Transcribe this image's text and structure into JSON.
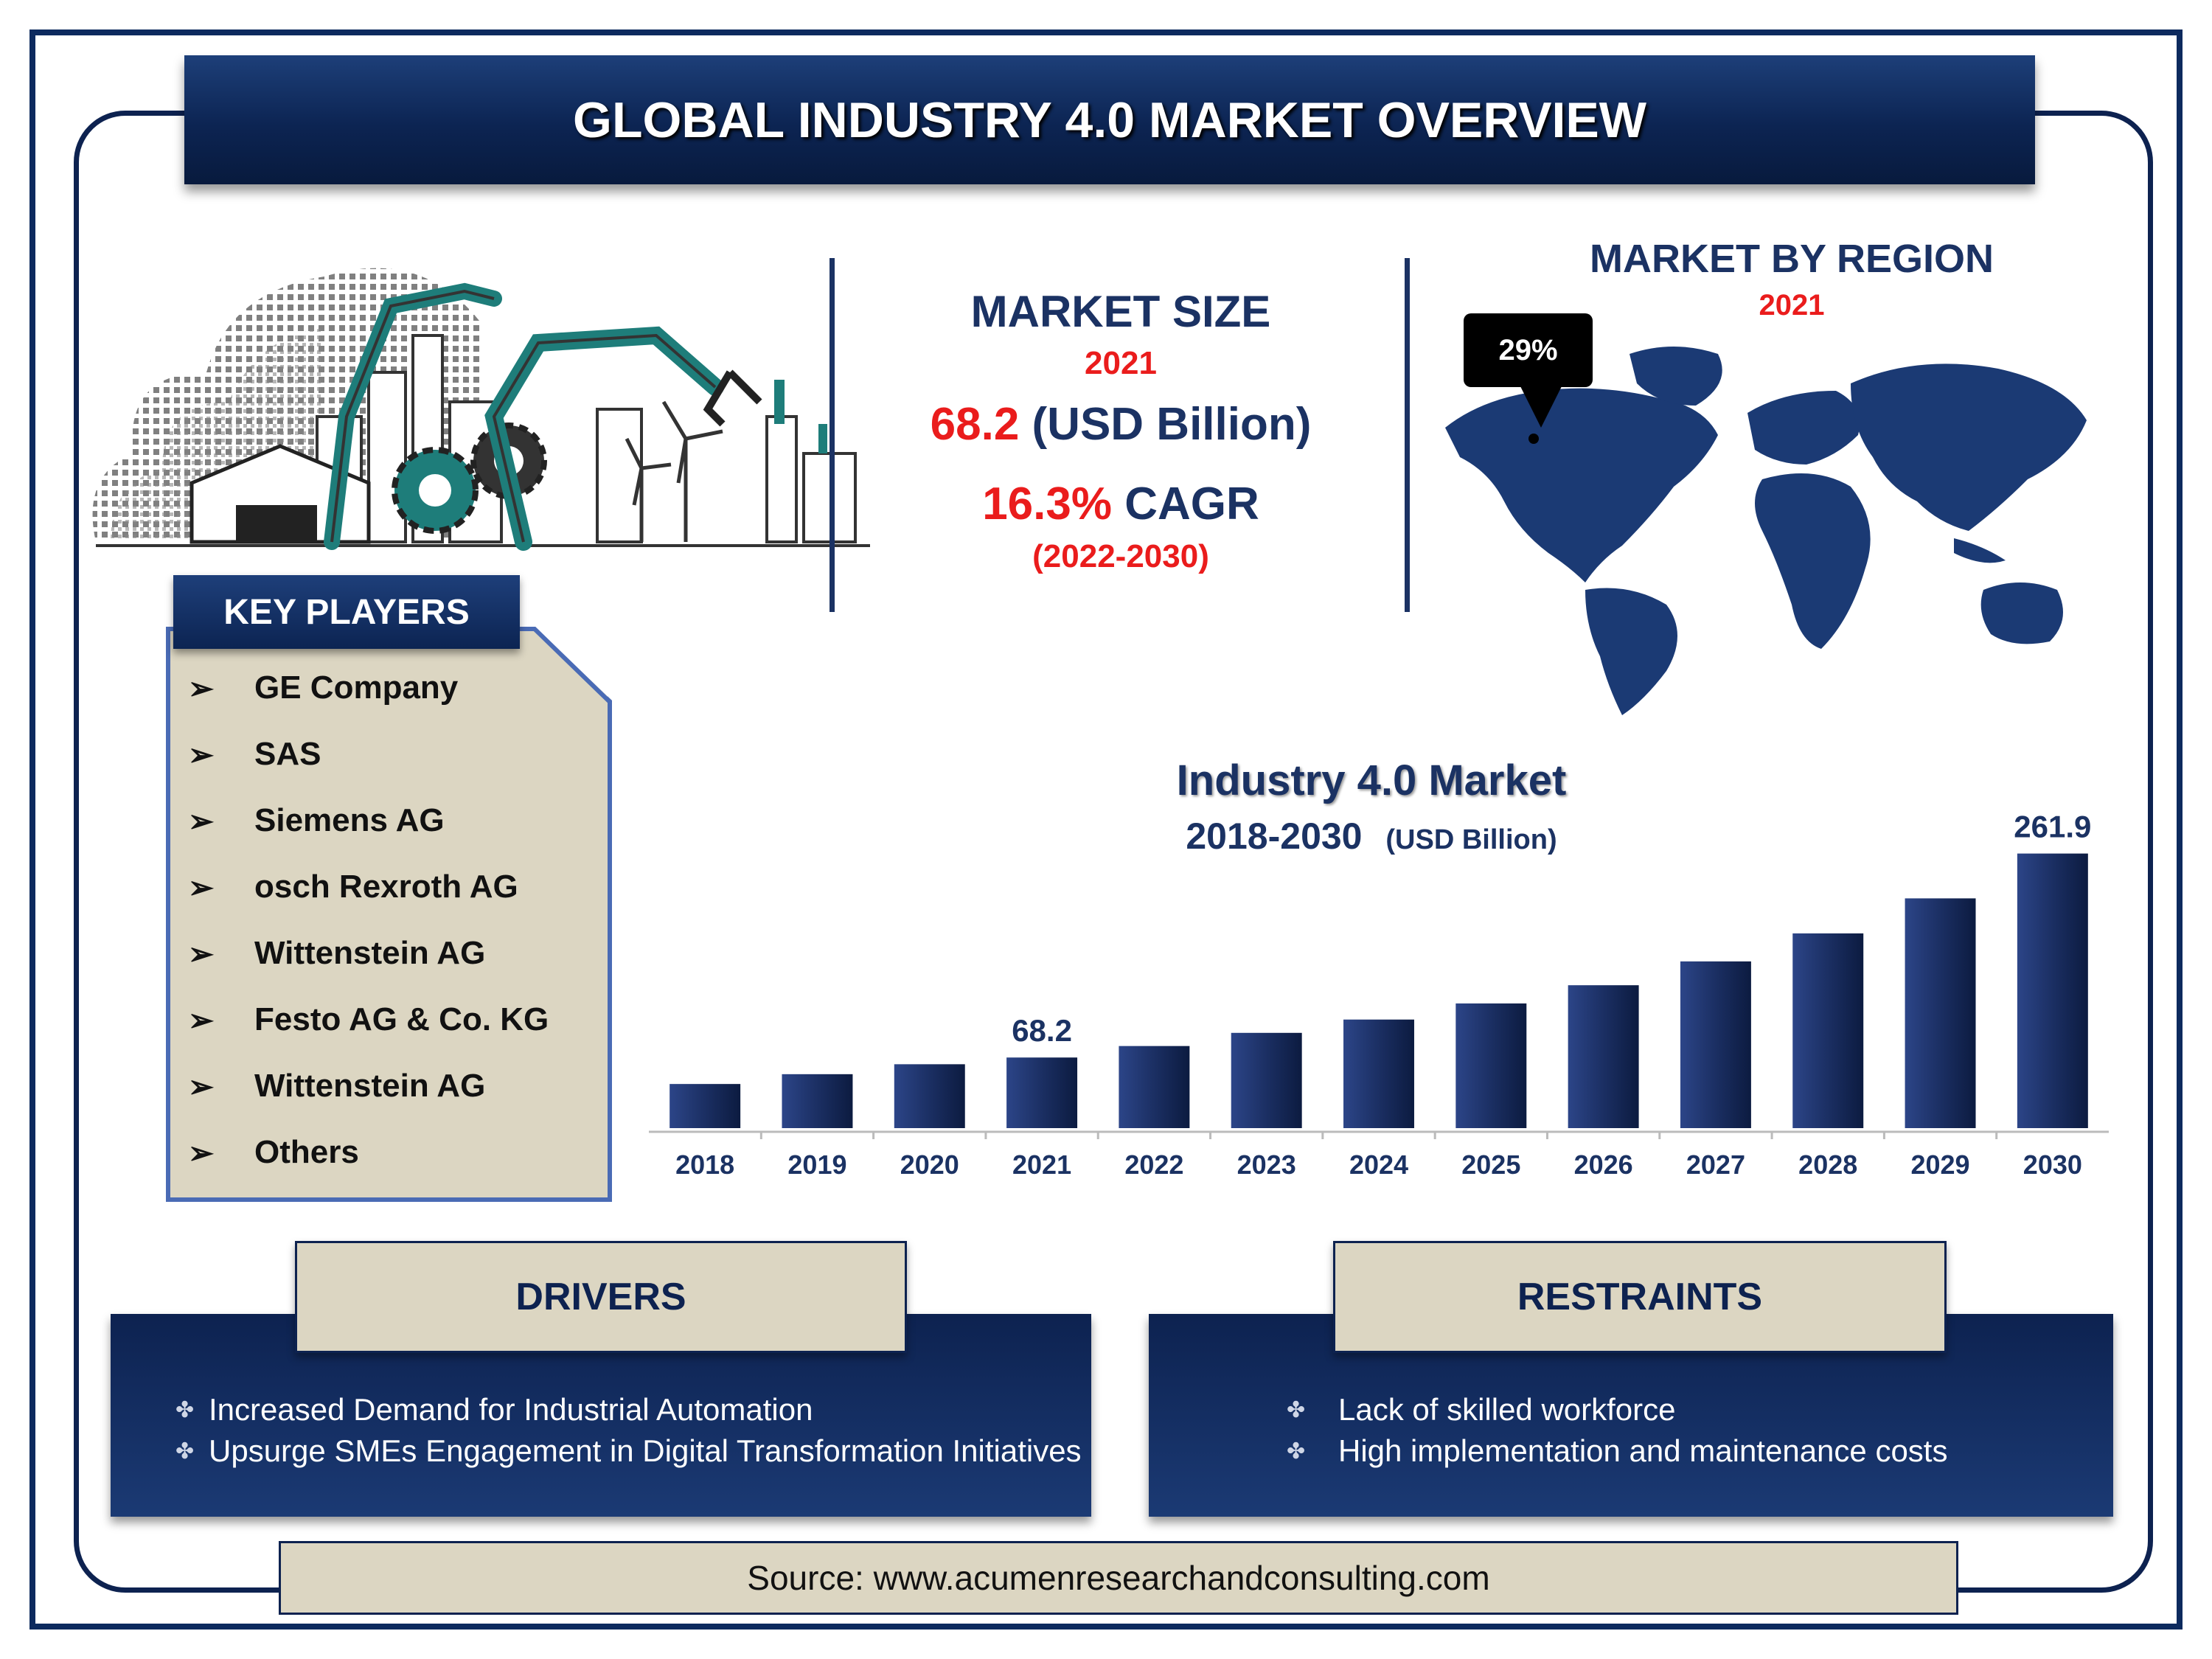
{
  "title": "GLOBAL INDUSTRY 4.0 MARKET OVERVIEW",
  "market_size": {
    "heading": "MARKET SIZE",
    "year": "2021",
    "value": "68.2",
    "unit": "(USD Billion)",
    "cagr_value": "16.3%",
    "cagr_label": "CAGR",
    "period": "(2022-2030)"
  },
  "market_by_region": {
    "heading": "MARKET BY REGION",
    "year": "2021",
    "callout": "29%"
  },
  "key_players": {
    "heading": "KEY PLAYERS",
    "items": [
      "GE Company",
      "SAS",
      "Siemens AG",
      "osch Rexroth AG",
      "Wittenstein AG",
      "Festo AG & Co. KG",
      "Wittenstein AG",
      "Others"
    ]
  },
  "chart_data": {
    "type": "bar",
    "title": "Industry 4.0 Market",
    "subtitle": "2018-2030",
    "unit_label": "(USD Billion)",
    "categories": [
      "2018",
      "2019",
      "2020",
      "2021",
      "2022",
      "2023",
      "2024",
      "2025",
      "2026",
      "2027",
      "2028",
      "2029",
      "2030"
    ],
    "values": [
      31.5,
      38.5,
      45.6,
      50.4,
      58.6,
      68.0,
      77.5,
      89.0,
      102.0,
      119.0,
      139.0,
      164.0,
      196.0
    ],
    "data_labels": [
      {
        "category": "2021",
        "text": "68.2"
      },
      {
        "category": "2030",
        "text": "261.9"
      }
    ],
    "ylim": [
      0,
      200
    ],
    "grid": false,
    "bar_color": "#1b2f63"
  },
  "drivers": {
    "heading": "DRIVERS",
    "items": [
      "Increased Demand for Industrial Automation",
      "Upsurge SMEs Engagement in Digital Transformation Initiatives"
    ]
  },
  "restraints": {
    "heading": "RESTRAINTS",
    "items": [
      "Lack of skilled workforce",
      "High implementation and maintenance costs"
    ]
  },
  "source": "Source: www.acumenresearchandconsulting.com"
}
